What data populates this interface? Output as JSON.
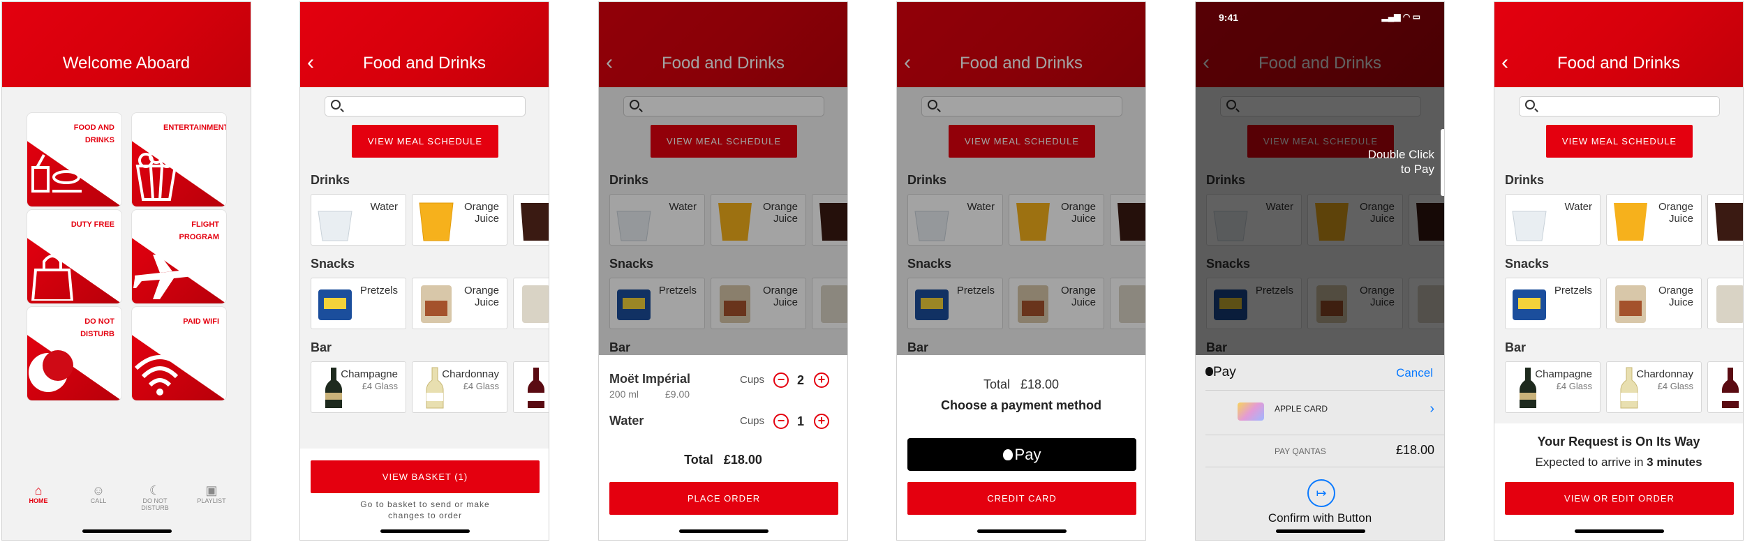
{
  "brand": {
    "red": "#e4000f",
    "dark_red": "#b8000a"
  },
  "screens": {
    "welcome": {
      "title": "Welcome Aboard",
      "tiles": [
        {
          "label": "FOOD AND DRINKS",
          "icon": "food-tray-icon"
        },
        {
          "label": "ENTERTAINMENT",
          "icon": "popcorn-icon"
        },
        {
          "label": "DUTY FREE",
          "icon": "shopping-bag-icon"
        },
        {
          "label": "FLIGHT PROGRAM",
          "icon": "airplane-icon"
        },
        {
          "label": "DO NOT DISTURB",
          "icon": "moon-icon"
        },
        {
          "label": "PAID WIFI",
          "icon": "wifi-icon"
        }
      ],
      "nav": [
        {
          "label": "HOME",
          "icon": "home-icon"
        },
        {
          "label": "CALL",
          "icon": "call-attendant-icon"
        },
        {
          "label": "DO NOT DISTURB",
          "icon": "moon-icon"
        },
        {
          "label": "PLAYLIST",
          "icon": "playlist-icon"
        }
      ]
    },
    "menu": {
      "title": "Food and Drinks",
      "meal_button": "VIEW MEAL SCHEDULE",
      "sections": {
        "drinks": {
          "title": "Drinks",
          "items": [
            {
              "label": "Water"
            },
            {
              "label": "Orange Juice"
            }
          ]
        },
        "snacks": {
          "title": "Snacks",
          "items": [
            {
              "label": "Pretzels"
            },
            {
              "label": "Orange Juice"
            }
          ]
        },
        "bar": {
          "title": "Bar",
          "items": [
            {
              "label": "Champagne",
              "sub": "£4 Glass"
            },
            {
              "label": "Chardonnay",
              "sub": "£4 Glass"
            }
          ]
        }
      },
      "basket_button": "VIEW BASKET (1)",
      "basket_note": "Go to basket to send or make changes to order"
    },
    "basket": {
      "items": [
        {
          "name": "Moët Impérial",
          "size": "200 ml",
          "price": "£9.00",
          "unit": "Cups",
          "qty": "2"
        },
        {
          "name": "Water",
          "unit": "Cups",
          "qty": "1"
        }
      ],
      "total_label": "Total",
      "total": "£18.00",
      "order_button": "PLACE ORDER"
    },
    "payment": {
      "total_label": "Total",
      "total": "£18.00",
      "prompt": "Choose a payment method",
      "apple_pay": "Pay",
      "credit_card": "CREDIT CARD"
    },
    "applepay": {
      "time": "9:41",
      "hint": "Double Click to Pay",
      "pay_title": "Pay",
      "cancel": "Cancel",
      "card_name": "APPLE CARD",
      "merchant": "PAY QANTAS",
      "amount": "£18.00",
      "confirm": "Confirm with Button"
    },
    "confirm": {
      "headline": "Your Request is On Its Way",
      "eta_prefix": "Expected to arrive in ",
      "eta": "3 minutes",
      "button": "VIEW OR EDIT ORDER"
    }
  }
}
